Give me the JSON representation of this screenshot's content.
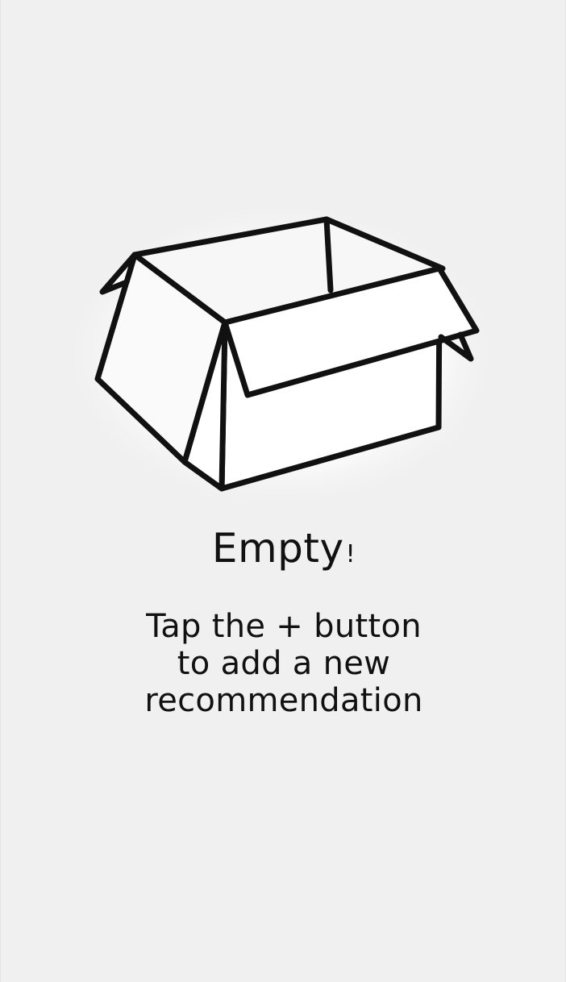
{
  "empty_state": {
    "illustration_icon": "open-box-icon",
    "title": "Empty",
    "title_punct": "!",
    "message_lines": [
      "Tap the  + button",
      "to add a new",
      "recommendation"
    ]
  },
  "colors": {
    "background": "#f0f0f0",
    "glow": "#ffffff",
    "ink": "#111111"
  }
}
